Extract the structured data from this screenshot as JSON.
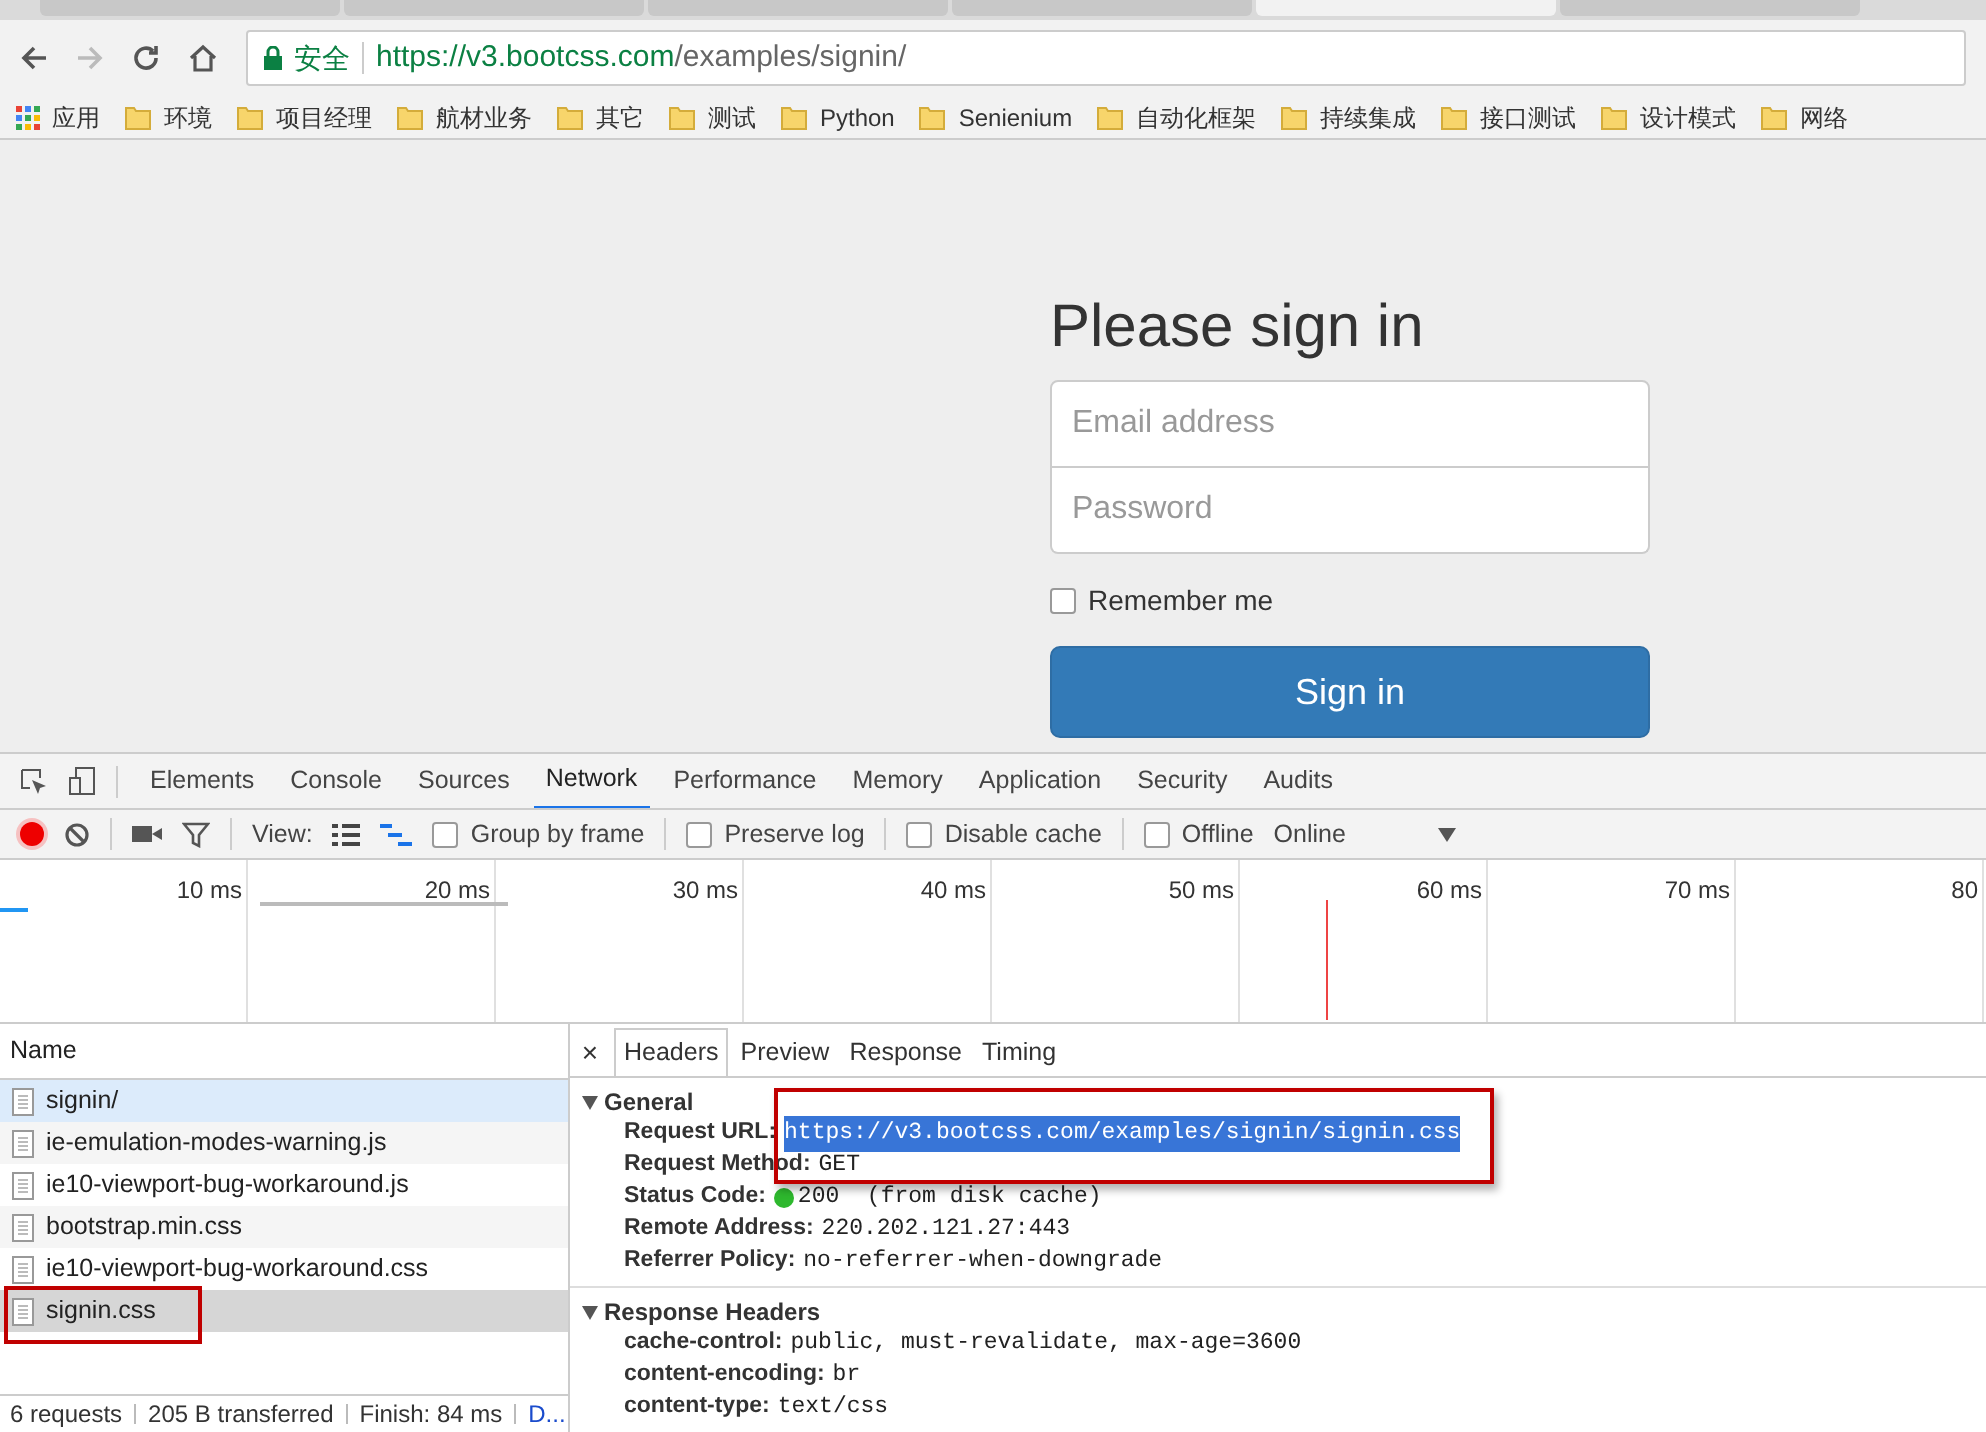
{
  "browser": {
    "secure_label": "安全",
    "url_host": "https://v3.bootcss.com",
    "url_path": "/examples/signin/",
    "bookmarks": [
      {
        "label": "应用",
        "kind": "apps"
      },
      {
        "label": "环境",
        "kind": "folder"
      },
      {
        "label": "项目经理",
        "kind": "folder"
      },
      {
        "label": "航材业务",
        "kind": "folder"
      },
      {
        "label": "其它",
        "kind": "folder"
      },
      {
        "label": "测试",
        "kind": "folder"
      },
      {
        "label": "Python",
        "kind": "folder"
      },
      {
        "label": "Senienium",
        "kind": "folder"
      },
      {
        "label": "自动化框架",
        "kind": "folder"
      },
      {
        "label": "持续集成",
        "kind": "folder"
      },
      {
        "label": "接口测试",
        "kind": "folder"
      },
      {
        "label": "设计模式",
        "kind": "folder"
      },
      {
        "label": "网络",
        "kind": "folder"
      }
    ]
  },
  "signin": {
    "title": "Please sign in",
    "email_placeholder": "Email address",
    "password_placeholder": "Password",
    "remember": {
      "label": "Remember me",
      "checked": false
    },
    "button": "Sign in"
  },
  "devtools": {
    "tabs": [
      {
        "label": "Elements",
        "selected": false
      },
      {
        "label": "Console",
        "selected": false
      },
      {
        "label": "Sources",
        "selected": false
      },
      {
        "label": "Network",
        "selected": true
      },
      {
        "label": "Performance",
        "selected": false
      },
      {
        "label": "Memory",
        "selected": false
      },
      {
        "label": "Application",
        "selected": false
      },
      {
        "label": "Security",
        "selected": false
      },
      {
        "label": "Audits",
        "selected": false
      }
    ],
    "toolbar": {
      "view_label": "View:",
      "checkboxes": [
        {
          "label": "Group by frame",
          "checked": false
        },
        {
          "label": "Preserve log",
          "checked": false
        },
        {
          "label": "Disable cache",
          "checked": false
        },
        {
          "label": "Offline",
          "checked": false
        }
      ],
      "throttle": "Online"
    },
    "timeline": {
      "ticks": [
        "10 ms",
        "20 ms",
        "30 ms",
        "40 ms",
        "50 ms",
        "60 ms",
        "70 ms",
        "80"
      ]
    },
    "requests": {
      "column": "Name",
      "rows": [
        {
          "name": "signin/",
          "hovered": true,
          "selected": false
        },
        {
          "name": "ie-emulation-modes-warning.js",
          "hovered": false,
          "selected": false
        },
        {
          "name": "ie10-viewport-bug-workaround.js",
          "hovered": false,
          "selected": false
        },
        {
          "name": "bootstrap.min.css",
          "hovered": false,
          "selected": false
        },
        {
          "name": "ie10-viewport-bug-workaround.css",
          "hovered": false,
          "selected": false
        },
        {
          "name": "signin.css",
          "hovered": false,
          "selected": true
        }
      ]
    },
    "status_bar": [
      "6 requests",
      "205 B transferred",
      "Finish: 84 ms",
      "D..."
    ],
    "detail": {
      "close": "×",
      "tabs": [
        {
          "label": "Headers",
          "selected": true
        },
        {
          "label": "Preview",
          "selected": false
        },
        {
          "label": "Response",
          "selected": false
        },
        {
          "label": "Timing",
          "selected": false
        }
      ],
      "sections": [
        {
          "title": "General",
          "expanded": true,
          "fields": [
            {
              "key": "Request URL:",
              "value": "https://v3.bootcss.com/examples/signin/signin.css",
              "highlighted": true
            },
            {
              "key": "Request Method:",
              "value": "GET",
              "highlighted": false
            },
            {
              "key": "Status Code:",
              "value": "200  (from disk cache)",
              "highlighted": false,
              "status_dot": true
            },
            {
              "key": "Remote Address:",
              "value": "220.202.121.27:443",
              "highlighted": false
            },
            {
              "key": "Referrer Policy:",
              "value": "no-referrer-when-downgrade",
              "highlighted": false
            }
          ]
        },
        {
          "title": "Response Headers",
          "expanded": true,
          "fields": [
            {
              "key": "cache-control:",
              "value": "public, must-revalidate, max-age=3600",
              "highlighted": false
            },
            {
              "key": "content-encoding:",
              "value": "br",
              "highlighted": false
            },
            {
              "key": "content-type:",
              "value": "text/css",
              "highlighted": false
            }
          ]
        }
      ]
    }
  }
}
